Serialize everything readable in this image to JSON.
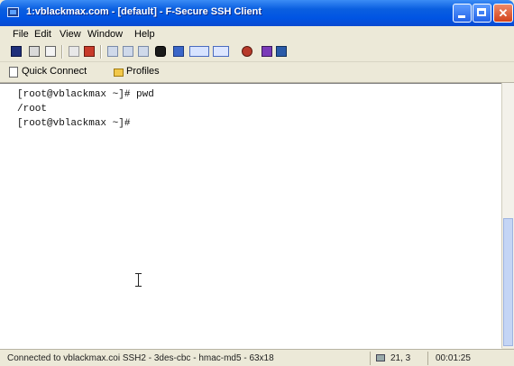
{
  "window": {
    "title": "1:vblackmax.com - [default] - F-Secure SSH Client",
    "minimize_label": "minimize",
    "maximize_label": "maximize",
    "close_label": "close"
  },
  "menu": {
    "items": [
      "File",
      "Edit",
      "View",
      "Window",
      "Help"
    ]
  },
  "toolbar": {
    "icons": [
      "save-icon",
      "print-icon",
      "print-preview-icon",
      "copy-icon",
      "paste-icon",
      "new-session-icon",
      "close-session-icon",
      "properties-icon",
      "find-icon",
      "sftp-icon",
      "keygen-icon",
      "settings-icon",
      "help-icon"
    ]
  },
  "quickbar": {
    "quick_connect_label": "Quick Connect",
    "profiles_label": "Profiles"
  },
  "terminal": {
    "lines": [
      "[root@vblackmax ~]# pwd",
      "/root",
      "[root@vblackmax ~]#"
    ]
  },
  "status": {
    "connection_text": "Connected to vblackmax.coi SSH2 - 3des-cbc - hmac-md5 - 63x18",
    "cursor_position": "21, 3",
    "elapsed_time": "00:01:25"
  },
  "colors": {
    "titlebar": "#0054e3",
    "chrome": "#ece9d8",
    "terminal_bg": "#ffffff"
  }
}
